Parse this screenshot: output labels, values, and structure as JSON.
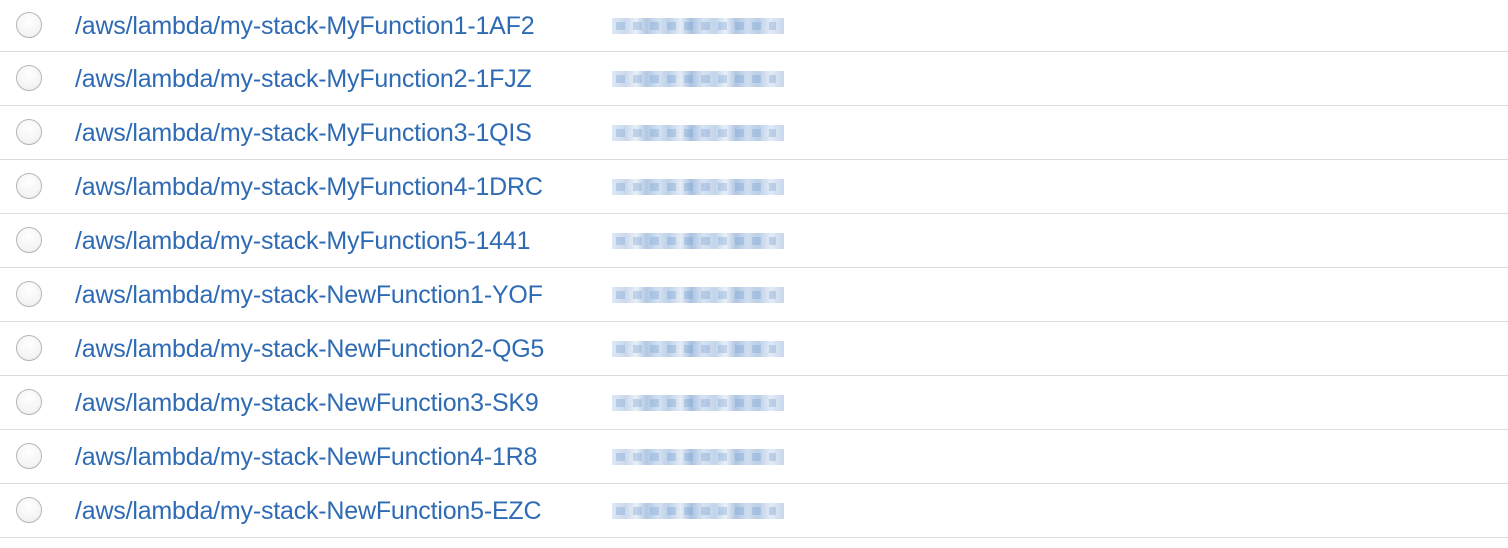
{
  "log_groups": [
    {
      "name": "/aws/lambda/my-stack-MyFunction1-1AF2"
    },
    {
      "name": "/aws/lambda/my-stack-MyFunction2-1FJZ"
    },
    {
      "name": "/aws/lambda/my-stack-MyFunction3-1QIS"
    },
    {
      "name": "/aws/lambda/my-stack-MyFunction4-1DRC"
    },
    {
      "name": "/aws/lambda/my-stack-MyFunction5-1441"
    },
    {
      "name": "/aws/lambda/my-stack-NewFunction1-YOF"
    },
    {
      "name": "/aws/lambda/my-stack-NewFunction2-QG5"
    },
    {
      "name": "/aws/lambda/my-stack-NewFunction3-SK9"
    },
    {
      "name": "/aws/lambda/my-stack-NewFunction4-1R8"
    },
    {
      "name": "/aws/lambda/my-stack-NewFunction5-EZC"
    }
  ],
  "colors": {
    "link": "#2e6bb4",
    "divider": "#dcdcdc",
    "radio_border": "#b6b6b6"
  }
}
